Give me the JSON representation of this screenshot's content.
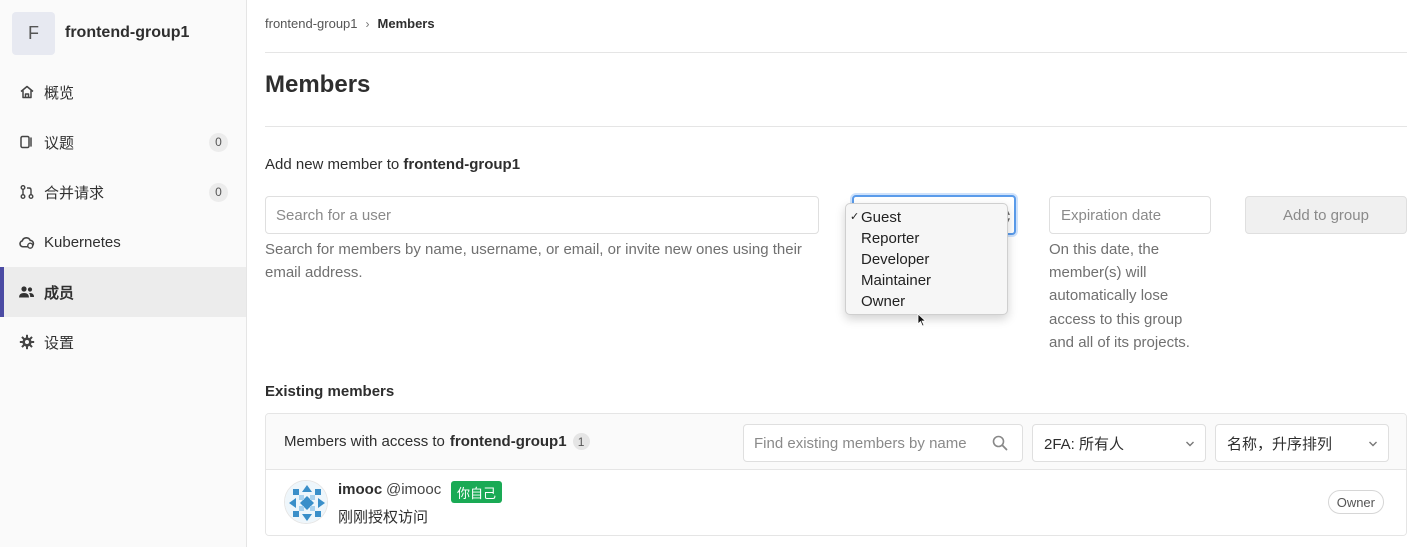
{
  "sidebar": {
    "group_avatar_letter": "F",
    "group_name": "frontend-group1",
    "items": [
      {
        "label": "概览",
        "icon": "home-icon"
      },
      {
        "label": "议题",
        "icon": "issues-icon",
        "count": "0"
      },
      {
        "label": "合并请求",
        "icon": "merge-request-icon",
        "count": "0"
      },
      {
        "label": "Kubernetes",
        "icon": "kubernetes-icon"
      },
      {
        "label": "成员",
        "icon": "users-icon",
        "active": true
      },
      {
        "label": "设置",
        "icon": "gear-icon"
      }
    ]
  },
  "breadcrumb": {
    "parent": "frontend-group1",
    "current": "Members"
  },
  "page": {
    "title": "Members"
  },
  "add_member": {
    "label_prefix": "Add new member to",
    "label_group": "frontend-group1",
    "search_placeholder": "Search for a user",
    "search_help": "Search for members by name, username, or email, or invite new ones using their email address.",
    "role_options": [
      "Guest",
      "Reporter",
      "Developer",
      "Maintainer",
      "Owner"
    ],
    "role_selected": "Guest",
    "expiration_placeholder": "Expiration date",
    "expiration_help": "On this date, the member(s) will automatically lose access to this group and all of its projects.",
    "add_button": "Add to group"
  },
  "existing": {
    "title": "Existing members",
    "header_prefix": "Members with access to",
    "header_group": "frontend-group1",
    "member_count": "1",
    "find_placeholder": "Find existing members by name",
    "filter_2fa": "2FA: 所有人",
    "sort": "名称，升序排列",
    "members": [
      {
        "name": "imooc",
        "username": "@imooc",
        "you_badge": "你自己",
        "access_text": "刚刚授权访问",
        "role": "Owner"
      }
    ]
  },
  "colors": {
    "accent": "#4b4ba3",
    "focus": "#5a9bea",
    "you_badge": "#1aaa55"
  }
}
